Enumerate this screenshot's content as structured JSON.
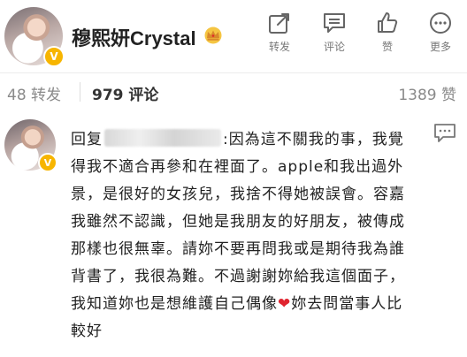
{
  "header": {
    "username": "穆熙妍Crystal",
    "verified_badge": "V",
    "actions": [
      {
        "label": "转发",
        "icon": "share-icon"
      },
      {
        "label": "评论",
        "icon": "comment-icon"
      },
      {
        "label": "赞",
        "icon": "thumbs-up-icon"
      },
      {
        "label": "更多",
        "icon": "more-icon"
      }
    ]
  },
  "stats": {
    "forward": "48 转发",
    "comment": "979 评论",
    "like": "1389 赞"
  },
  "comment": {
    "reply_prefix": "回复",
    "text_after_blur": ":因為這不關我的事，我覺得我不適合再參和在裡面了。apple和我出過外景，是很好的女孩兒，我捨不得她被誤會。容嘉我雖然不認識，但她是我朋友的好朋友，被傳成那樣也很無辜。請妳不要再問我或是期待我為誰背書了，我很為難。不過謝謝妳給我這個面子，我知道妳也是想維護自己偶像",
    "heart": "❤",
    "text_end": "妳去問當事人比較好",
    "verified_badge": "V"
  },
  "colors": {
    "verified": "#f7b500",
    "heart": "#e0242f",
    "muted": "#8a8a8a"
  }
}
